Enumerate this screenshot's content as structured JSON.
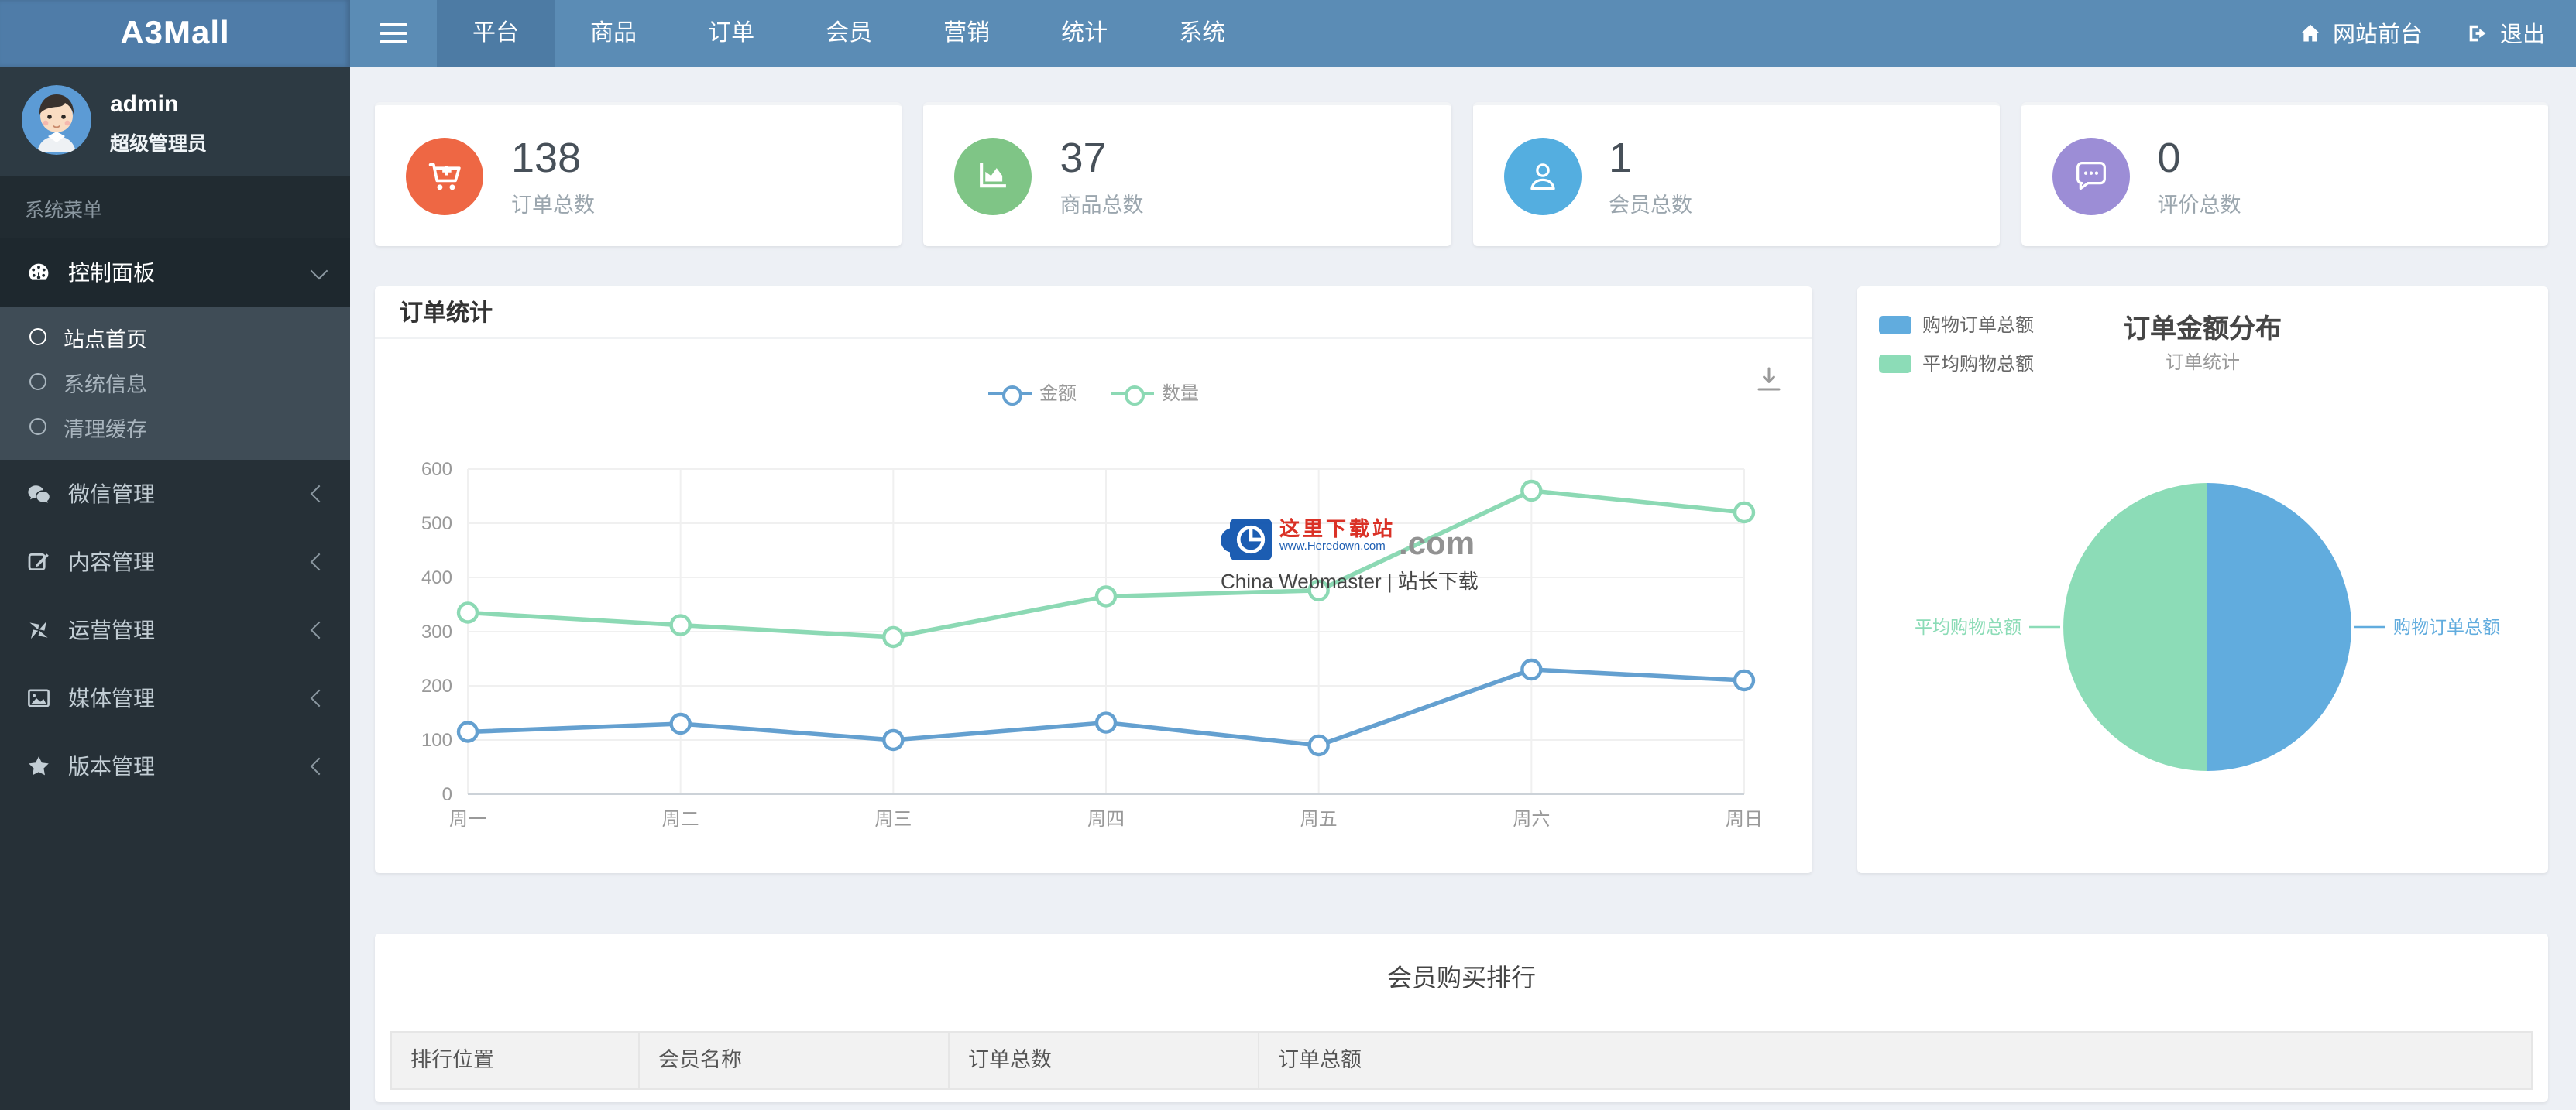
{
  "navbar": {
    "brand": "A3Mall",
    "tabs": [
      {
        "label": "平台",
        "active": true
      },
      {
        "label": "商品",
        "active": false
      },
      {
        "label": "订单",
        "active": false
      },
      {
        "label": "会员",
        "active": false
      },
      {
        "label": "营销",
        "active": false
      },
      {
        "label": "统计",
        "active": false
      },
      {
        "label": "系统",
        "active": false
      }
    ],
    "right": [
      {
        "label": "网站前台",
        "icon": "home-icon"
      },
      {
        "label": "退出",
        "icon": "logout-icon"
      }
    ],
    "colors": {
      "base": "#5b8cb5",
      "active": "#4d7ba4",
      "brand_bg": "#4f7ca8"
    }
  },
  "sidebar": {
    "user": {
      "name": "admin",
      "role": "超级管理员"
    },
    "section_label": "系统菜单",
    "menu": [
      {
        "label": "控制面板",
        "icon": "gauge-icon",
        "active": true,
        "expanded": true,
        "children": [
          {
            "label": "站点首页",
            "active": true
          },
          {
            "label": "系统信息",
            "active": false
          },
          {
            "label": "清理缓存",
            "active": false
          }
        ]
      },
      {
        "label": "微信管理",
        "icon": "wechat-icon",
        "active": false,
        "expanded": false,
        "children": []
      },
      {
        "label": "内容管理",
        "icon": "edit-icon",
        "active": false,
        "expanded": false,
        "children": []
      },
      {
        "label": "运营管理",
        "icon": "pinwheel-icon",
        "active": false,
        "expanded": false,
        "children": []
      },
      {
        "label": "媒体管理",
        "icon": "image-icon",
        "active": false,
        "expanded": false,
        "children": []
      },
      {
        "label": "版本管理",
        "icon": "star-icon",
        "active": false,
        "expanded": false,
        "children": []
      }
    ]
  },
  "stats": [
    {
      "value": "138",
      "label": "订单总数",
      "icon": "cart-plus-icon",
      "color": "#ee6744"
    },
    {
      "value": "37",
      "label": "商品总数",
      "icon": "area-chart-icon",
      "color": "#7fc586"
    },
    {
      "value": "1",
      "label": "会员总数",
      "icon": "user-icon",
      "color": "#54aee0"
    },
    {
      "value": "0",
      "label": "评价总数",
      "icon": "comment-icon",
      "color": "#9c8dd6"
    }
  ],
  "chart_data": [
    {
      "type": "line",
      "title": "订单统计",
      "categories": [
        "周一",
        "周二",
        "周三",
        "周四",
        "周五",
        "周六",
        "周日"
      ],
      "series": [
        {
          "name": "金额",
          "color": "#64a0d0",
          "values": [
            115,
            130,
            100,
            132,
            90,
            230,
            210
          ]
        },
        {
          "name": "数量",
          "color": "#8cd9b4",
          "values": [
            335,
            312,
            290,
            365,
            376,
            560,
            520
          ]
        }
      ],
      "ylim": [
        0,
        600
      ],
      "ytick_step": 100,
      "grid": true,
      "legend_position": "top-center",
      "toolbox": [
        "download-icon"
      ]
    },
    {
      "type": "pie",
      "title": "订单金额分布",
      "subtitle": "订单统计",
      "slices": [
        {
          "name": "购物订单总额",
          "value": 50,
          "color": "#61acde",
          "label_side": "right"
        },
        {
          "name": "平均购物总额",
          "value": 50,
          "color": "#8cdcb7",
          "label_side": "left"
        }
      ],
      "legend_position": "top-left"
    }
  ],
  "watermark": {
    "site_name": "这里下载站",
    "site_url": "www.Heredown.com",
    "com": ".com",
    "caption": "China Webmaster | 站长下载"
  },
  "ranking": {
    "title": "会员购买排行",
    "columns": [
      "排行位置",
      "会员名称",
      "订单总数",
      "订单总额"
    ]
  }
}
